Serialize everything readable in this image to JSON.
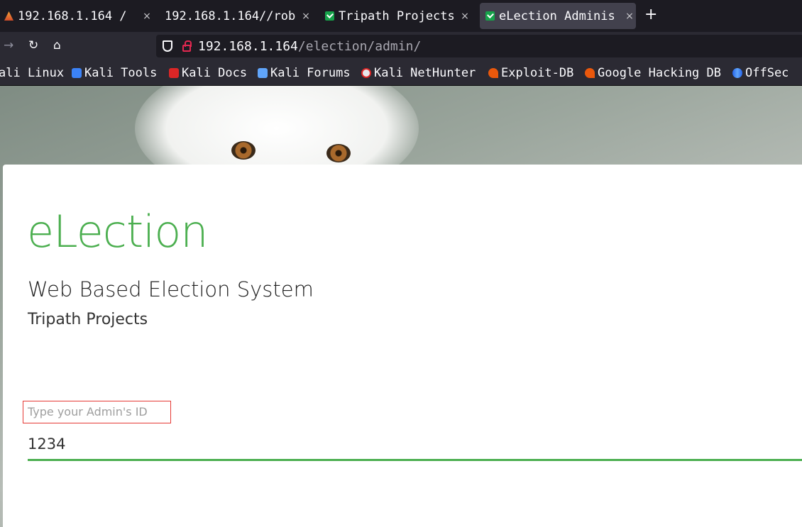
{
  "browser": {
    "tabs": [
      {
        "title": "192.168.1.164 /",
        "favicon": "kali-icon",
        "active": false
      },
      {
        "title": "192.168.1.164//rob",
        "favicon": "",
        "active": false
      },
      {
        "title": "Tripath Projects",
        "favicon": "check-shield-icon",
        "active": false
      },
      {
        "title": "eLection Adminis",
        "favicon": "check-shield-icon",
        "active": true
      }
    ],
    "new_tab": "+",
    "close_glyph": "×",
    "url_host": "192.168.1.164",
    "url_path": "/election/admin/",
    "bookmarks": [
      {
        "label": "ali Linux",
        "icon": ""
      },
      {
        "label": "Kali Tools",
        "icon": "kali-tools-icon"
      },
      {
        "label": "Kali Docs",
        "icon": "kali-docs-icon"
      },
      {
        "label": "Kali Forums",
        "icon": "kali-forums-icon"
      },
      {
        "label": "Kali NetHunter",
        "icon": "nethunter-icon"
      },
      {
        "label": "Exploit-DB",
        "icon": "exploit-db-icon"
      },
      {
        "label": "Google Hacking DB",
        "icon": "ghdb-icon"
      },
      {
        "label": "OffSec",
        "icon": "offsec-icon"
      }
    ]
  },
  "page": {
    "brand": "eLection",
    "subtitle": "Web Based Election System",
    "org": "Tripath Projects",
    "admin_id_label": "Type your Admin's ID",
    "admin_id_value": "1234"
  },
  "colors": {
    "accent": "#4caf50",
    "highlight_box": "#e53935"
  }
}
